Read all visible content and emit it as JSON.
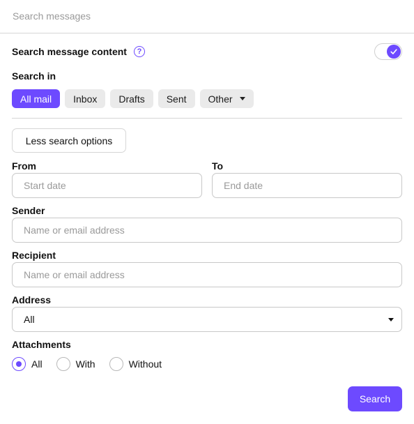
{
  "search": {
    "placeholder": "Search messages"
  },
  "content_toggle": {
    "label": "Search message content",
    "enabled": true
  },
  "search_in": {
    "label": "Search in",
    "options": [
      {
        "label": "All mail",
        "selected": true
      },
      {
        "label": "Inbox",
        "selected": false
      },
      {
        "label": "Drafts",
        "selected": false
      },
      {
        "label": "Sent",
        "selected": false
      },
      {
        "label": "Other",
        "selected": false
      }
    ]
  },
  "less_options_label": "Less search options",
  "from": {
    "label": "From",
    "placeholder": "Start date"
  },
  "to": {
    "label": "To",
    "placeholder": "End date"
  },
  "sender": {
    "label": "Sender",
    "placeholder": "Name or email address"
  },
  "recipient": {
    "label": "Recipient",
    "placeholder": "Name or email address"
  },
  "address": {
    "label": "Address",
    "value": "All"
  },
  "attachments": {
    "label": "Attachments",
    "options": [
      {
        "label": "All",
        "checked": true
      },
      {
        "label": "With",
        "checked": false
      },
      {
        "label": "Without",
        "checked": false
      }
    ]
  },
  "submit_label": "Search",
  "colors": {
    "accent": "#6d4aff",
    "chip_bg": "#eaeaea",
    "border": "#c8c8c8"
  },
  "icons": [
    "help-icon",
    "check-icon",
    "chevron-down-icon"
  ]
}
